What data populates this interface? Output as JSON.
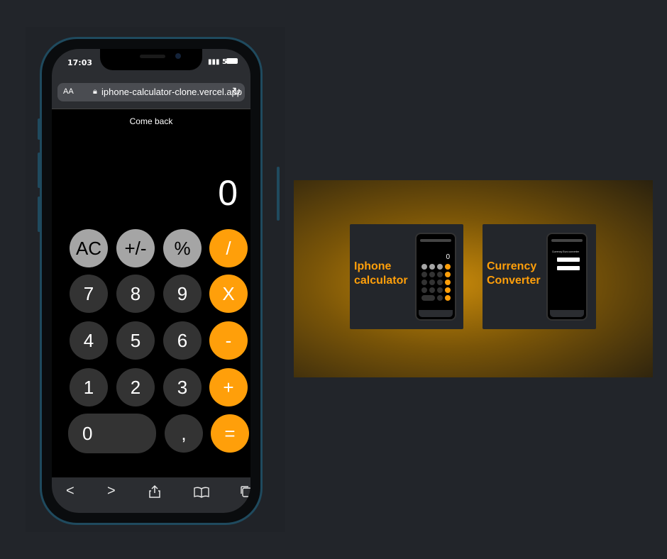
{
  "status": {
    "time": "17:03",
    "signal": "5G"
  },
  "browser": {
    "aa": "AA",
    "url": "iphone-calculator-clone.vercel.app",
    "reload_icon": "reload-icon"
  },
  "app": {
    "come_back": "Come back",
    "display_value": "0"
  },
  "keys": {
    "ac": "AC",
    "sign": "+/-",
    "percent": "%",
    "divide": "/",
    "seven": "7",
    "eight": "8",
    "nine": "9",
    "multiply": "X",
    "four": "4",
    "five": "5",
    "six": "6",
    "minus": "-",
    "one": "1",
    "two": "2",
    "three": "3",
    "plus": "+",
    "zero": "0",
    "comma": ",",
    "equals": "="
  },
  "toolbar": {
    "back": "<",
    "forward": ">",
    "share": "share-icon",
    "bookmarks": "book-icon",
    "tabs": "tabs-icon"
  },
  "projects": [
    {
      "title": "Iphone calculator",
      "mini_display": "0"
    },
    {
      "title": "Currency Converter",
      "mini_heading": "Currency Euro converter"
    }
  ],
  "colors": {
    "accent": "#ff9f0a",
    "function_key": "#a5a5a5",
    "number_key": "#333333",
    "background": "#22252a"
  }
}
